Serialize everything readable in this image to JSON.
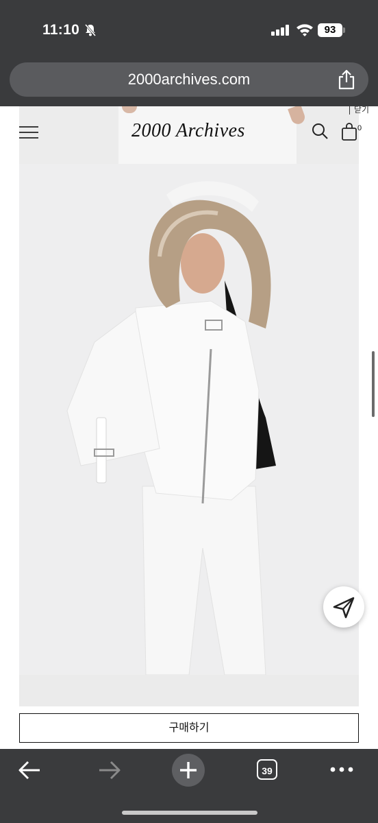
{
  "status_bar": {
    "time": "11:10",
    "battery": "93"
  },
  "browser": {
    "url": "2000archives.com",
    "tab_count": "39"
  },
  "site": {
    "close_label": "닫기",
    "logo": "2000 Archives",
    "cart_count": "0",
    "buy_label": "구매하기"
  },
  "icons": {
    "menu": "menu-icon",
    "search": "search-icon",
    "cart": "cart-icon",
    "share": "share-icon",
    "send": "send-icon"
  },
  "colors": {
    "chrome": "#3a3b3d",
    "url_bar": "#5a5b5e",
    "page_bg": "#ffffff"
  }
}
